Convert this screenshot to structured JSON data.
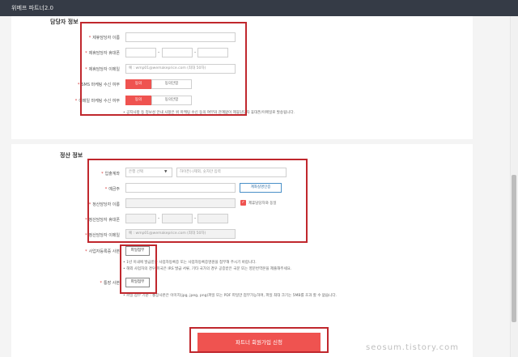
{
  "app": {
    "title": "위메프 파트너2.0"
  },
  "section_contact": {
    "title": "담당자 정보",
    "name_label": "제휴담당자 이름",
    "phone_label": "제휴담당자 휴대폰",
    "phone_dash": "-",
    "email_label": "제휴담당자 이메일",
    "email_placeholder": "예 : wmp01@wemakeprice.com (최대 50자)",
    "sms_label": "SMS 마케팅 수신 여부",
    "email_mkt_label": "이메일 마케팅 수신 여부",
    "agree_label": "동의",
    "disagree_label": "동의안함",
    "notice": "• 공지사항 등 정보성 안내 사항은 위 마케팅 수신 동의 여부와 관계없이 제휴담당자 휴대폰/이메일로 발송됩니다."
  },
  "section_settlement": {
    "title": "정산 정보",
    "account_label": "입출계좌",
    "bank_select": "은행 선택",
    "account_placeholder": "하이픈(-)제외, 숫자만 입력",
    "holder_label": "예금주",
    "verify_button": "계좌실명인증",
    "sett_name_label": "정산담당자 이름",
    "same_as_label": "제휴담당자와 동일",
    "sett_phone_label": "정산담당자 휴대폰",
    "sett_email_label": "정산담당자 이메일",
    "sett_email_placeholder": "예 : wmp01@wemakeprice.com (최대 50자)",
    "biz_cert_label": "사업자등록증 사본",
    "attach_button": "파일첨부",
    "biz_note_1": "• 1년 이내에 발급받은 사업자등록증 또는 사업자등록증명원을 첨부해 주시기 바랍니다.",
    "biz_note_2": "• 해외 사업자의 경우 미국은 IRS 발급 서류, 기타 국가의 경우 공증받은 국문 또는 영문번역본을 제출해주세요.",
    "bankbook_label": "통장 사본",
    "bankbook_note": "• 파일 첨부 기준 : 통장사본은 이미지(jpg, jpeg, png)파일 또는 PDF 파일만 첨부가능하며, 파일 최대 크기는 5MB를 초과 할 수 없습니다."
  },
  "submit": {
    "label": "파트너 회원가입 신청"
  },
  "watermark": "seosum.tistory.com",
  "colors": {
    "accent": "#ef5350",
    "highlight_box": "#c0272d",
    "topbar": "#353b46"
  }
}
